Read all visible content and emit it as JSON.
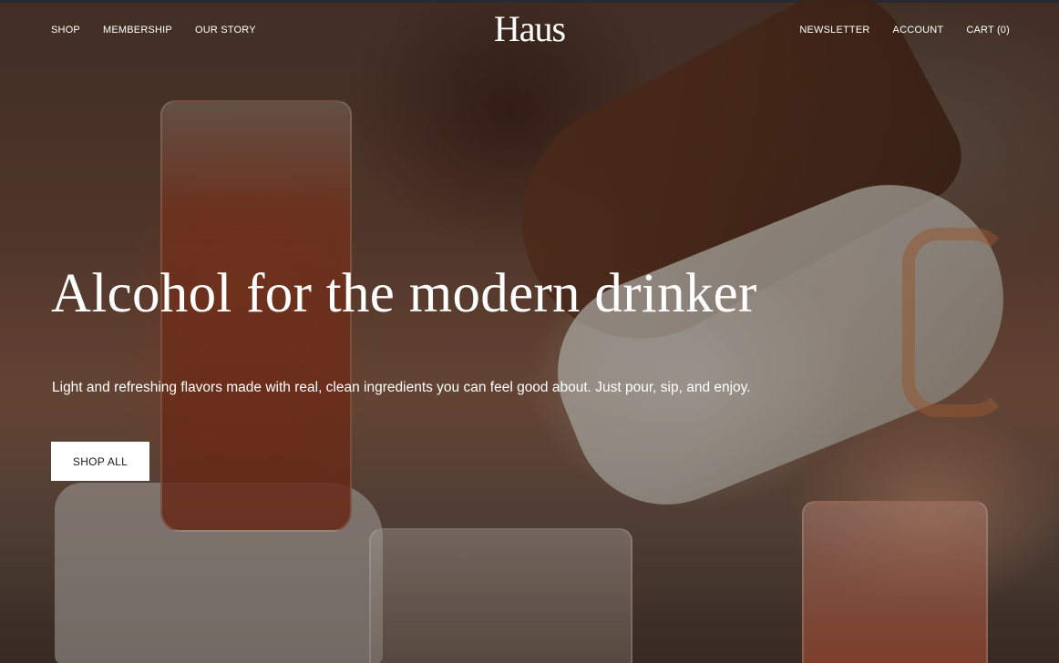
{
  "header": {
    "nav_left": [
      "SHOP",
      "MEMBERSHIP",
      "OUR STORY"
    ],
    "logo": "Haus",
    "nav_right": [
      "NEWSLETTER",
      "ACCOUNT",
      "CART (0)"
    ]
  },
  "hero": {
    "headline": "Alcohol for the modern drinker",
    "subheadline": "Light and refreshing flavors made with real, clean ingredients you can feel good about. Just pour, sip, and enjoy.",
    "cta_label": "SHOP ALL"
  },
  "colors": {
    "text": "#ffffff",
    "button_bg": "#ffffff",
    "button_text": "#1a1a1a"
  }
}
